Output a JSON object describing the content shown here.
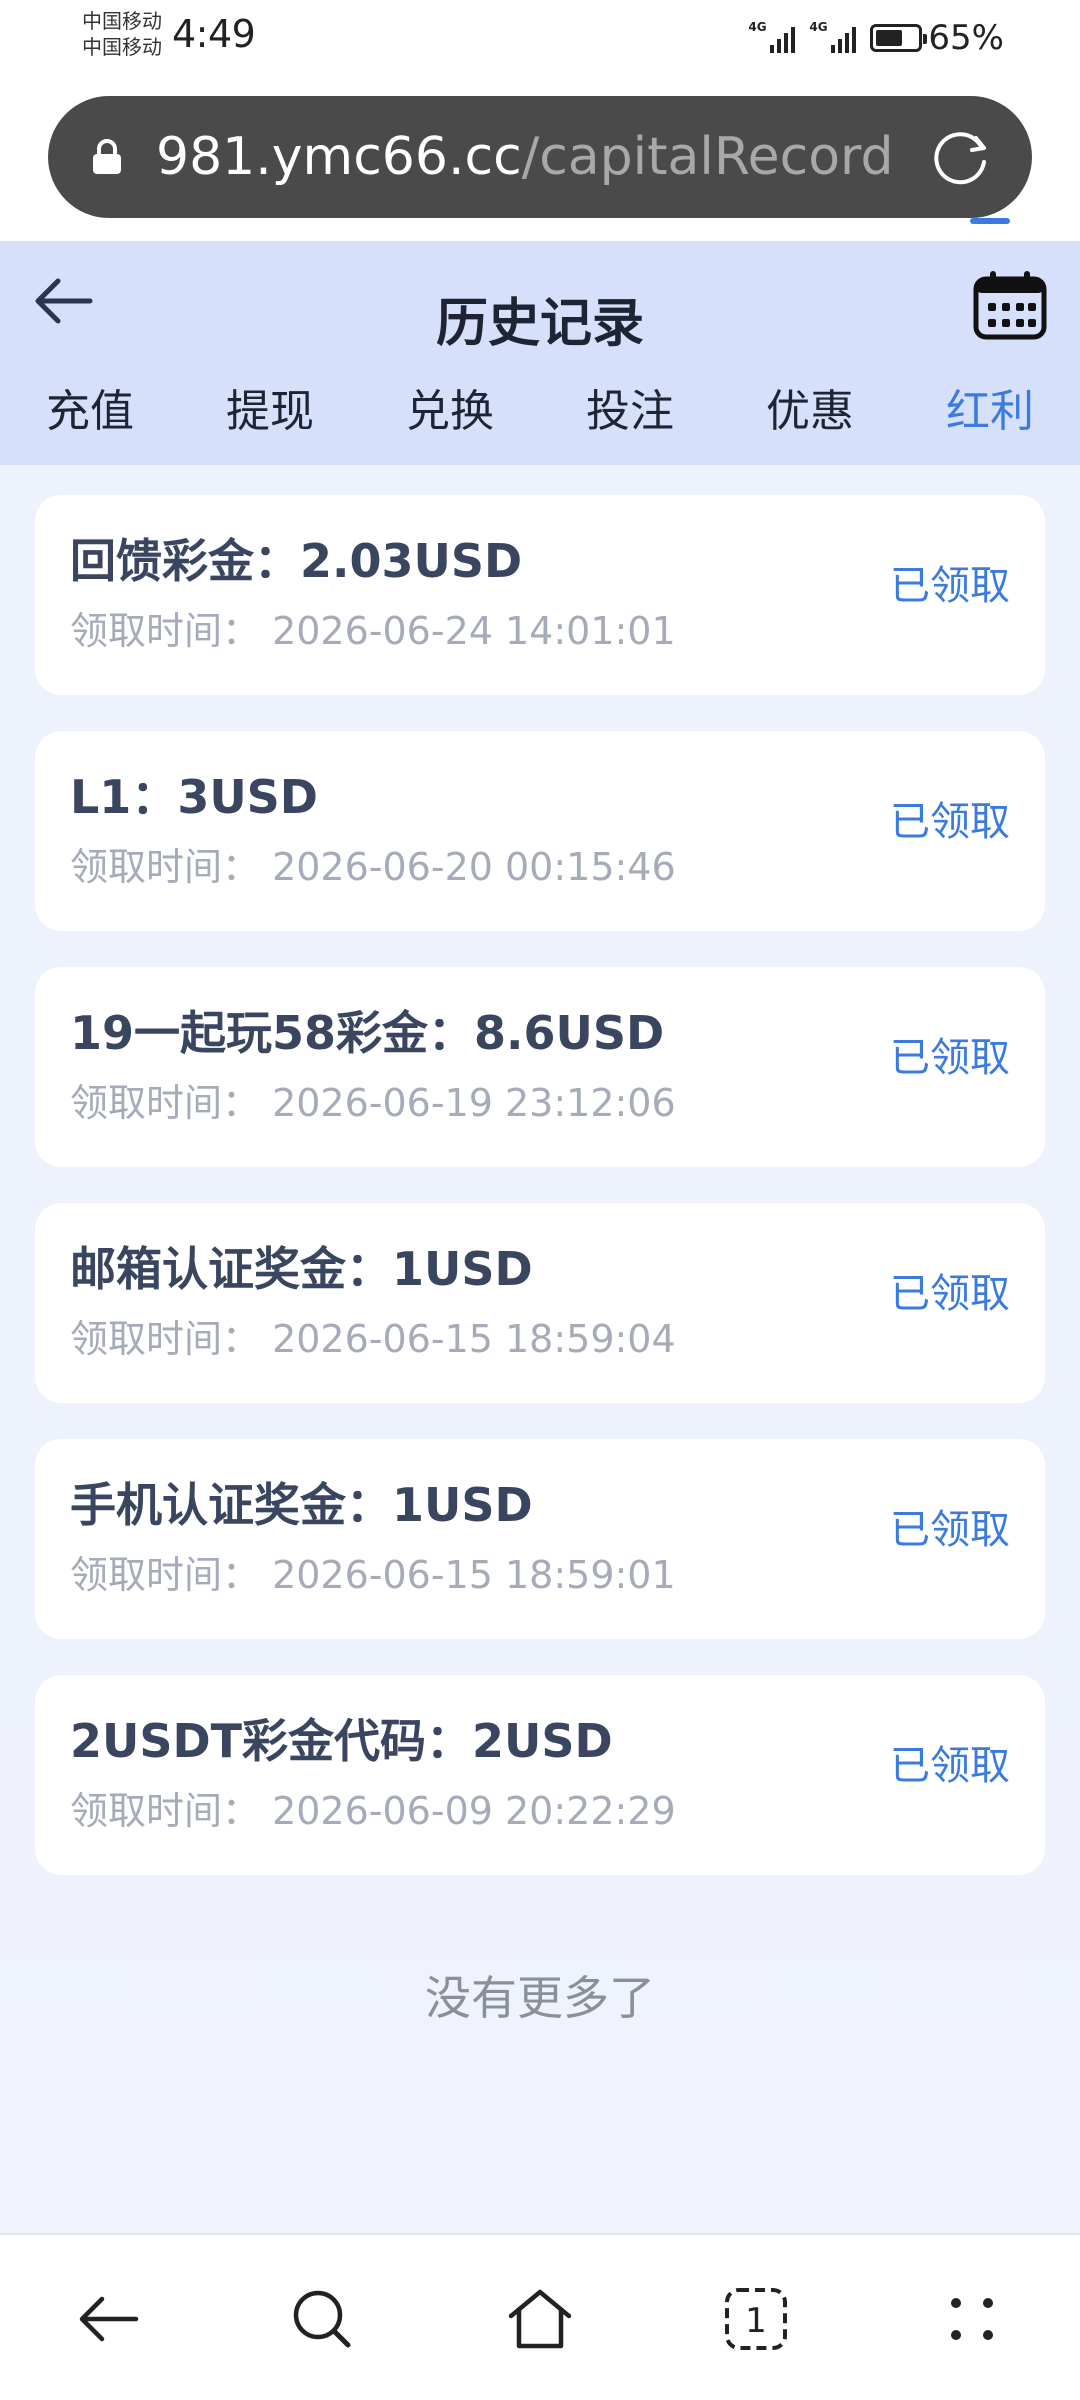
{
  "status_bar": {
    "carrier_1": "中国移动",
    "carrier_2": "中国移动",
    "time": "4:49",
    "network_1": "4G",
    "network_2": "4G",
    "battery_percent": "65%",
    "battery_level": 0.65
  },
  "browser": {
    "url_host": "981.ymc66.cc",
    "url_path": "/capitalRecord",
    "lock_icon": "lock-icon",
    "reload_icon": "reload-icon"
  },
  "header": {
    "title": "历史记录",
    "back_icon": "arrow-left-icon",
    "calendar_icon": "calendar-icon"
  },
  "tabs": [
    {
      "label": "充值",
      "active": false
    },
    {
      "label": "提现",
      "active": false
    },
    {
      "label": "兑换",
      "active": false
    },
    {
      "label": "投注",
      "active": false
    },
    {
      "label": "优惠",
      "active": false
    },
    {
      "label": "红利",
      "active": true
    }
  ],
  "records": [
    {
      "title": "回馈彩金：2.03USD",
      "time": "领取时间：  2026-06-24 14:01:01",
      "status": "已领取"
    },
    {
      "title": "L1：3USD",
      "time": "领取时间：  2026-06-20 00:15:46",
      "status": "已领取"
    },
    {
      "title": "19一起玩58彩金：8.6USD",
      "time": "领取时间：  2026-06-19 23:12:06",
      "status": "已领取"
    },
    {
      "title": "邮箱认证奖金：1USD",
      "time": "领取时间：  2026-06-15 18:59:04",
      "status": "已领取"
    },
    {
      "title": "手机认证奖金：1USD",
      "time": "领取时间：  2026-06-15 18:59:01",
      "status": "已领取"
    },
    {
      "title": "2USDT彩金代码：2USD",
      "time": "领取时间：  2026-06-09 20:22:29",
      "status": "已领取"
    }
  ],
  "footer_text": "没有更多了",
  "colors": {
    "accent": "#3b7be0",
    "header_bg": "#d6e0fb",
    "content_bg": "#eef2fc",
    "url_bar_bg": "#4a4a4a"
  },
  "bottom_nav": [
    {
      "icon": "back-arrow-icon"
    },
    {
      "icon": "search-icon"
    },
    {
      "icon": "home-icon"
    },
    {
      "icon": "tabs-icon",
      "count": "1"
    },
    {
      "icon": "menu-dots-icon"
    }
  ]
}
